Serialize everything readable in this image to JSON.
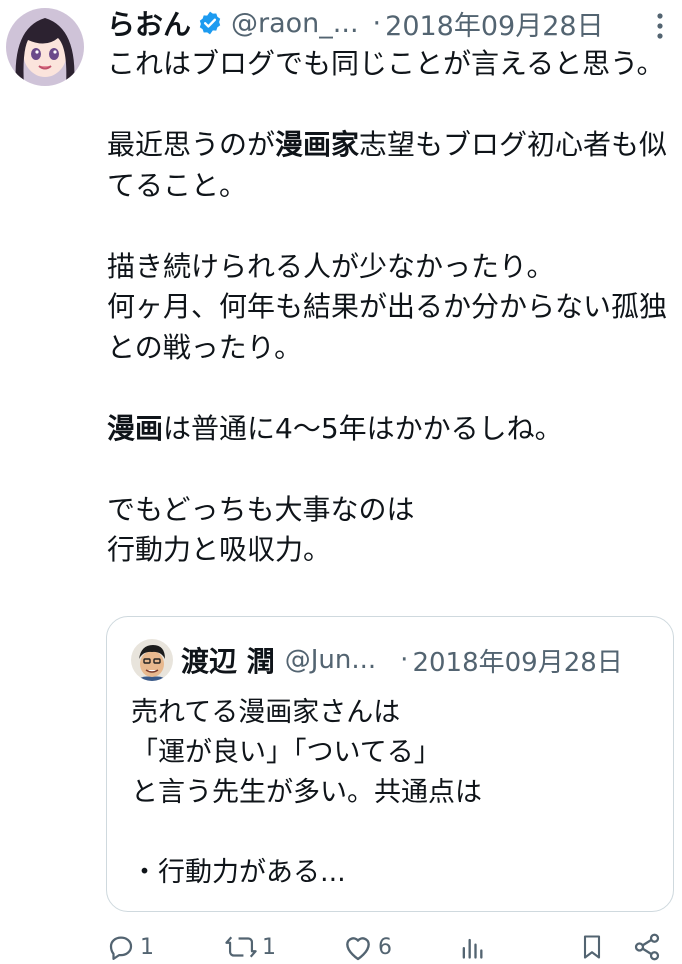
{
  "tweet": {
    "author": {
      "display_name": "らおん",
      "handle": "@raon_...",
      "verified": true
    },
    "separator": "·",
    "date": "2018年09月28日",
    "body": [
      {
        "text": "これはブログでも同じことが言えると思う。\n\n最近思うのが",
        "bold": false
      },
      {
        "text": "漫画家",
        "bold": true
      },
      {
        "text": "志望もブログ初心者も似てること。\n\n描き続けられる人が少なかったり。\n何ヶ月、何年も結果が出るか分からない孤独との戦ったり。\n\n",
        "bold": false
      },
      {
        "text": "漫画",
        "bold": true
      },
      {
        "text": "は普通に4〜5年はかかるしね。\n\nでもどっちも大事なのは\n行動力と吸収力。",
        "bold": false
      }
    ],
    "quote": {
      "display_name": "渡辺 潤",
      "handle": "@Jun...",
      "separator": "·",
      "date": "2018年09月28日",
      "text": "売れてる漫画家さんは\n「運が良い」「ついてる」\nと言う先生が多い。共通点は\n\n・行動力がある..."
    },
    "actions": {
      "reply_count": "1",
      "retweet_count": "1",
      "like_count": "6",
      "icons": [
        "reply-icon",
        "retweet-icon",
        "like-icon",
        "views-icon",
        "bookmark-icon",
        "share-icon"
      ]
    },
    "colors": {
      "text": "#0f1419",
      "secondary": "#536471",
      "verified": "#1d9bf0",
      "border": "#cfd9de"
    }
  }
}
